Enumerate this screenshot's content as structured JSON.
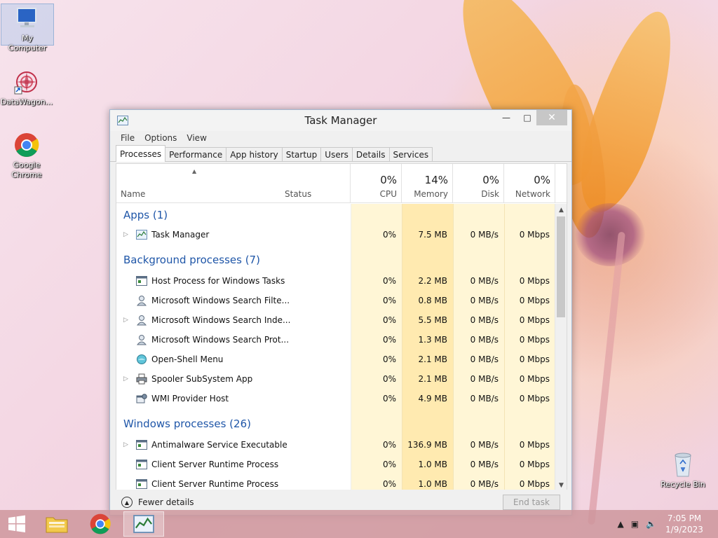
{
  "desktop": {
    "icons": [
      {
        "label": "My Computer"
      },
      {
        "label": "DataWagon..."
      },
      {
        "label": "Google Chrome"
      },
      {
        "label": "Recycle Bin"
      }
    ]
  },
  "window": {
    "title": "Task Manager",
    "menu": [
      "File",
      "Options",
      "View"
    ],
    "tabs": [
      "Processes",
      "Performance",
      "App history",
      "Startup",
      "Users",
      "Details",
      "Services"
    ],
    "active_tab": "Processes",
    "columns": {
      "name": "Name",
      "status": "Status",
      "cpu": {
        "pct": "0%",
        "label": "CPU"
      },
      "memory": {
        "pct": "14%",
        "label": "Memory"
      },
      "disk": {
        "pct": "0%",
        "label": "Disk"
      },
      "network": {
        "pct": "0%",
        "label": "Network"
      }
    },
    "groups": {
      "apps": "Apps (1)",
      "background": "Background processes (7)",
      "windows": "Windows processes (26)"
    },
    "processes": [
      {
        "name": "Task Manager",
        "cpu": "0%",
        "memory": "7.5 MB",
        "disk": "0 MB/s",
        "network": "0 Mbps"
      },
      {
        "name": "Host Process for Windows Tasks",
        "cpu": "0%",
        "memory": "2.2 MB",
        "disk": "0 MB/s",
        "network": "0 Mbps"
      },
      {
        "name": "Microsoft Windows Search Filte...",
        "cpu": "0%",
        "memory": "0.8 MB",
        "disk": "0 MB/s",
        "network": "0 Mbps"
      },
      {
        "name": "Microsoft Windows Search Inde...",
        "cpu": "0%",
        "memory": "5.5 MB",
        "disk": "0 MB/s",
        "network": "0 Mbps"
      },
      {
        "name": "Microsoft Windows Search Prot...",
        "cpu": "0%",
        "memory": "1.3 MB",
        "disk": "0 MB/s",
        "network": "0 Mbps"
      },
      {
        "name": "Open-Shell Menu",
        "cpu": "0%",
        "memory": "2.1 MB",
        "disk": "0 MB/s",
        "network": "0 Mbps"
      },
      {
        "name": "Spooler SubSystem App",
        "cpu": "0%",
        "memory": "2.1 MB",
        "disk": "0 MB/s",
        "network": "0 Mbps"
      },
      {
        "name": "WMI Provider Host",
        "cpu": "0%",
        "memory": "4.9 MB",
        "disk": "0 MB/s",
        "network": "0 Mbps"
      },
      {
        "name": "Antimalware Service Executable",
        "cpu": "0%",
        "memory": "136.9 MB",
        "disk": "0 MB/s",
        "network": "0 Mbps"
      },
      {
        "name": "Client Server Runtime Process",
        "cpu": "0%",
        "memory": "1.0 MB",
        "disk": "0 MB/s",
        "network": "0 Mbps"
      },
      {
        "name": "Client Server Runtime Process",
        "cpu": "0%",
        "memory": "1.0 MB",
        "disk": "0 MB/s",
        "network": "0 Mbps"
      }
    ],
    "footer": {
      "fewer_details": "Fewer details",
      "end_task": "End task"
    }
  },
  "taskbar": {
    "time": "7:05 PM",
    "date": "1/9/2023"
  },
  "colors": {
    "group_title": "#1f56a8",
    "cpu_shade": "#fff6d6",
    "memory_shade": "#ffeab0"
  }
}
